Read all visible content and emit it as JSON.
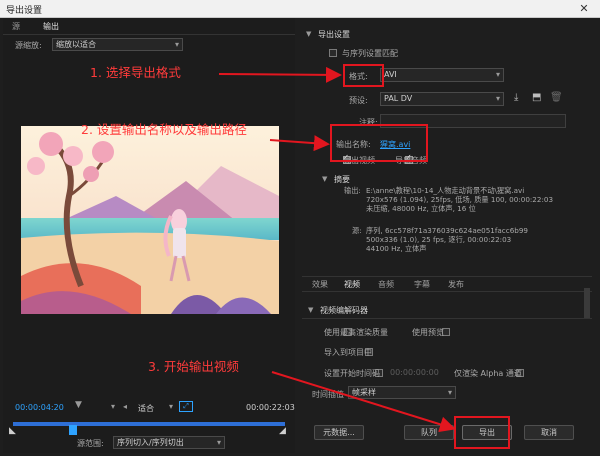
{
  "window": {
    "title": "导出设置",
    "close_label": "✕"
  },
  "left": {
    "tabs": [
      "源",
      "输出"
    ],
    "active_tab": "输出",
    "source_scaling_label": "源缩放:",
    "source_scaling_value": "缩放以适合",
    "timecode_current": "00:00:04:20",
    "timecode_end": "00:00:22:03",
    "fit_label": "适合",
    "range_label": "源范围:",
    "range_value": "序列切入/序列切出"
  },
  "right": {
    "section_title": "导出设置",
    "match_sequence_label": "与序列设置匹配",
    "format_label": "格式:",
    "format_value": "AVI",
    "preset_label": "预设:",
    "preset_value": "PAL DV",
    "comments_label": "注释:",
    "output_name_label": "输出名称:",
    "output_name_value": "猩窝.avi",
    "export_video_label": "导出视频",
    "export_audio_label": "导出音频",
    "summary_title": "摘要",
    "summary_output_label": "输出:",
    "summary_output_lines": [
      "E:\\anne\\教程\\10-14_人物走动背景不动\\猩窝.avi",
      "720x576 (1.094), 25fps, 低场, 质量 100, 00:00:22:03",
      "未压缩, 48000 Hz, 立体声, 16 位"
    ],
    "summary_source_label": "源:",
    "summary_source_lines": [
      "序列, 6cc578f71a376039c624ae051facc6b99",
      "500x336 (1.0), 25 fps, 逐行, 00:00:22:03",
      "44100 Hz, 立体声"
    ],
    "tabs": [
      "效果",
      "视频",
      "音频",
      "字幕",
      "发布"
    ],
    "active_tab": "视频",
    "codec_section": "视频编解码器",
    "use_max_render_label": "使用最高渲染质量",
    "use_previews_label": "使用预览",
    "import_project_label": "导入到项目中",
    "set_start_tc_label": "设置开始时间码",
    "start_tc_value": "00:00:00:00",
    "render_alpha_label": "仅渲染 Alpha 通道",
    "time_interp_label": "时间插值",
    "time_interp_value": "帧采样",
    "buttons": {
      "metadata": "元数据...",
      "queue": "队列",
      "export": "导出",
      "cancel": "取消"
    }
  },
  "annotations": {
    "step1": "1. 选择导出格式",
    "step2": "2. 设置输出名称以及输出路径",
    "step3": "3. 开始输出视频"
  },
  "colors": {
    "accent": "#2ea3ff",
    "annotation": "#e2161f"
  }
}
